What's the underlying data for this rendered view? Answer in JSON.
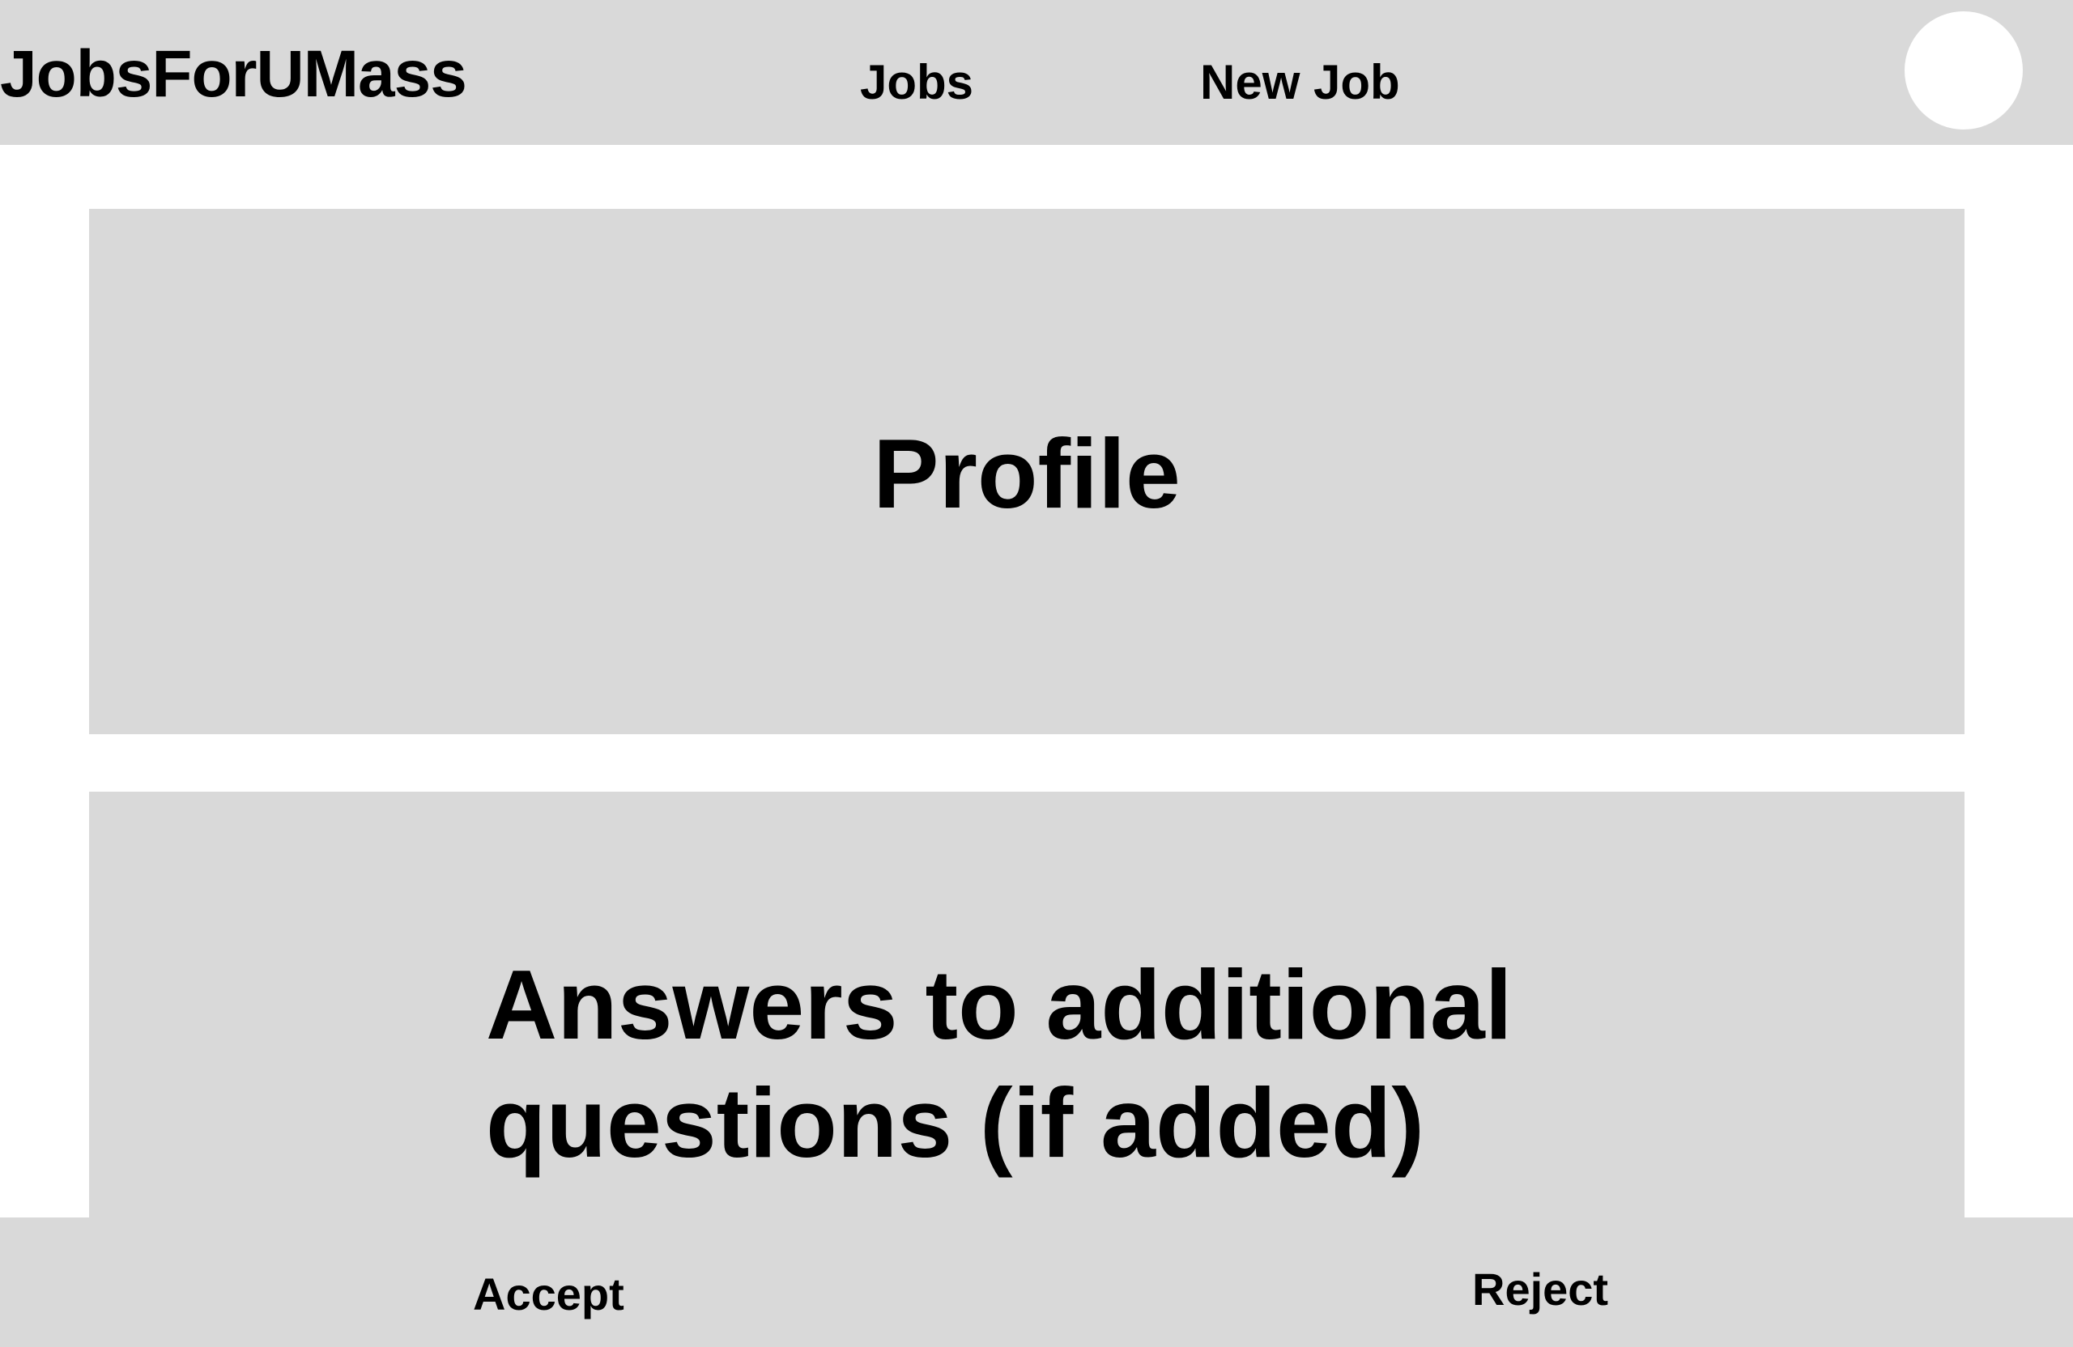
{
  "header": {
    "brand": "JobsForUMass",
    "nav": {
      "jobs": "Jobs",
      "new_job": "New Job"
    },
    "avatar_icon": "user-avatar-circle"
  },
  "main": {
    "profile_panel": {
      "title": "Profile"
    },
    "answers_panel": {
      "title": "Answers to additional questions (if added)"
    }
  },
  "footer": {
    "accept_label": "Accept",
    "reject_label": "Reject"
  },
  "colors": {
    "panel_background": "#d9d9d9",
    "page_background": "#ffffff",
    "text": "#000000"
  }
}
